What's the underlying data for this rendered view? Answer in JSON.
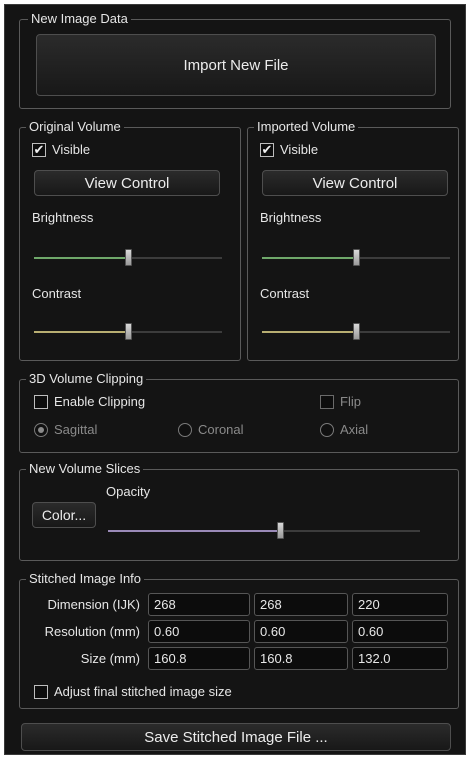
{
  "new_image_data": {
    "legend": "New Image Data",
    "import_button": "Import New File"
  },
  "original_volume": {
    "legend": "Original Volume",
    "visible_label": "Visible",
    "visible_checked": true,
    "view_control_button": "View Control",
    "brightness_label": "Brightness",
    "brightness_value": 0.5,
    "contrast_label": "Contrast",
    "contrast_value": 0.5
  },
  "imported_volume": {
    "legend": "Imported Volume",
    "visible_label": "Visible",
    "visible_checked": true,
    "view_control_button": "View Control",
    "brightness_label": "Brightness",
    "brightness_value": 0.5,
    "contrast_label": "Contrast",
    "contrast_value": 0.5
  },
  "clipping": {
    "legend": "3D Volume Clipping",
    "enable_label": "Enable Clipping",
    "enable_checked": false,
    "flip_label": "Flip",
    "flip_checked": false,
    "radios": [
      {
        "label": "Sagittal",
        "selected": true
      },
      {
        "label": "Coronal",
        "selected": false
      },
      {
        "label": "Axial",
        "selected": false
      }
    ]
  },
  "slices": {
    "legend": "New Volume Slices",
    "opacity_label": "Opacity",
    "color_button": "Color...",
    "opacity_value": 0.55
  },
  "stitched_info": {
    "legend": "Stitched Image Info",
    "rows": [
      {
        "label": "Dimension (IJK)",
        "values": [
          "268",
          "268",
          "220"
        ]
      },
      {
        "label": "Resolution (mm)",
        "values": [
          "0.60",
          "0.60",
          "0.60"
        ]
      },
      {
        "label": "Size (mm)",
        "values": [
          "160.8",
          "160.8",
          "132.0"
        ]
      }
    ],
    "adjust_label": "Adjust final stitched image size",
    "adjust_checked": false
  },
  "save_button": "Save Stitched Image File ...",
  "colors": {
    "brightness_fill": "#6fa86a",
    "contrast_fill": "#b8ae72",
    "opacity_fill": "#9a8ab8"
  }
}
